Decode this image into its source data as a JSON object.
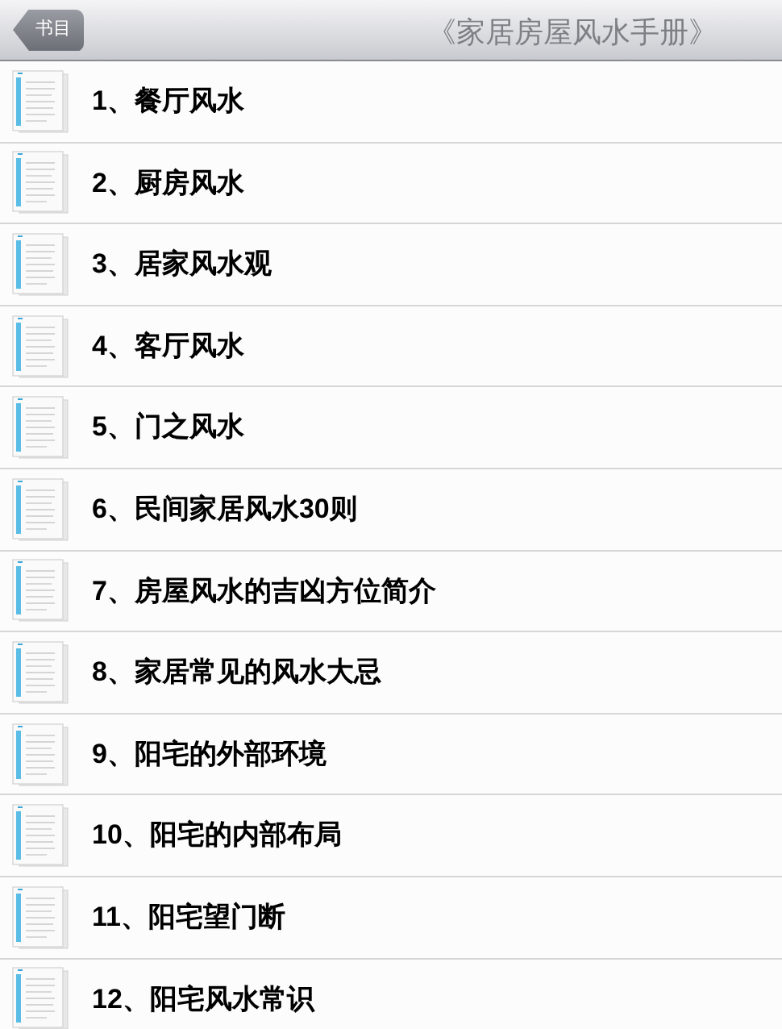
{
  "nav_bar": {
    "back_button": "书目",
    "title": "《家居房屋风水手册》"
  },
  "chapters": [
    {
      "label": "1、餐厅风水"
    },
    {
      "label": "2、厨房风水"
    },
    {
      "label": "3、居家风水观"
    },
    {
      "label": "4、客厅风水"
    },
    {
      "label": "5、门之风水"
    },
    {
      "label": "6、民间家居风水30则"
    },
    {
      "label": "7、房屋风水的吉凶方位简介"
    },
    {
      "label": "8、家居常见的风水大忌"
    },
    {
      "label": "9、阳宅的外部环境"
    },
    {
      "label": "10、阳宅的内部布局"
    },
    {
      "label": "11、阳宅望门断"
    },
    {
      "label": "12、阳宅风水常识"
    }
  ]
}
